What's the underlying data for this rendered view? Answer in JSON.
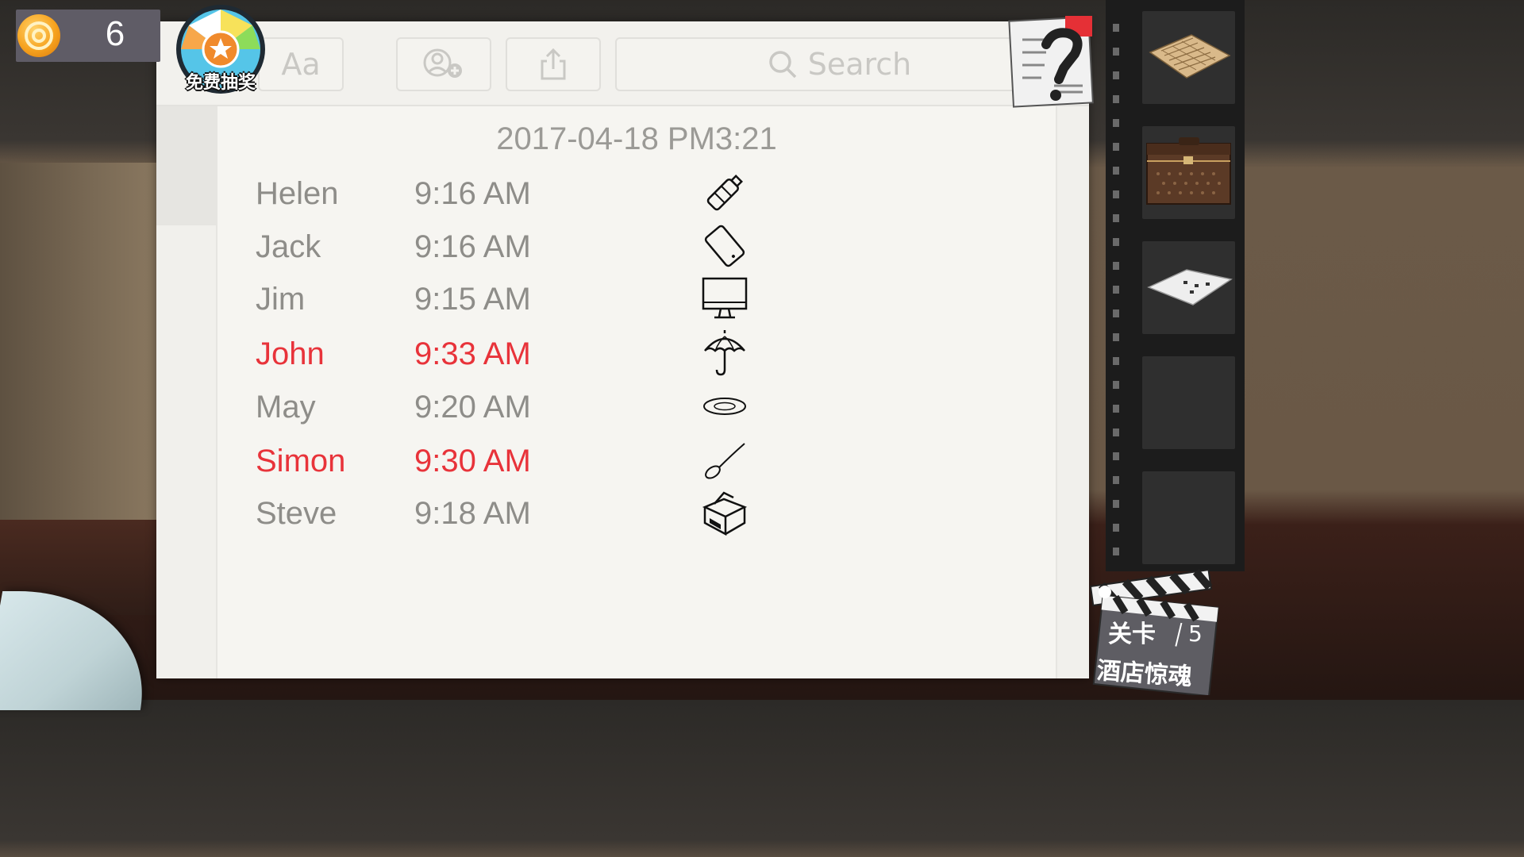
{
  "hud": {
    "coins": "6",
    "lottery_label": "免费抽奖"
  },
  "toolbar": {
    "font_label": "Aa",
    "search_placeholder": "Search"
  },
  "note": {
    "date": "2017-04-18 PM3:21",
    "entries": [
      {
        "name": "Helen",
        "time": "9:16 AM",
        "icon": "bottle-icon",
        "highlight": false
      },
      {
        "name": "Jack",
        "time": "9:16 AM",
        "icon": "phone-icon",
        "highlight": false
      },
      {
        "name": "Jim",
        "time": "9:15 AM",
        "icon": "monitor-icon",
        "highlight": false
      },
      {
        "name": "John",
        "time": "9:33 AM",
        "icon": "umbrella-icon",
        "highlight": true
      },
      {
        "name": "May",
        "time": "9:20 AM",
        "icon": "plate-icon",
        "highlight": false
      },
      {
        "name": "Simon",
        "time": "9:30 AM",
        "icon": "spoon-icon",
        "highlight": true
      },
      {
        "name": "Steve",
        "time": "9:18 AM",
        "icon": "box-icon",
        "highlight": false
      }
    ],
    "highlight_color": "#e8333a"
  },
  "inventory": {
    "items": [
      "paper-map-icon",
      "suitcase-icon",
      "paper-card-icon",
      "",
      ""
    ]
  },
  "level": {
    "label": "关卡",
    "number": "5",
    "title": "酒店惊魂"
  }
}
